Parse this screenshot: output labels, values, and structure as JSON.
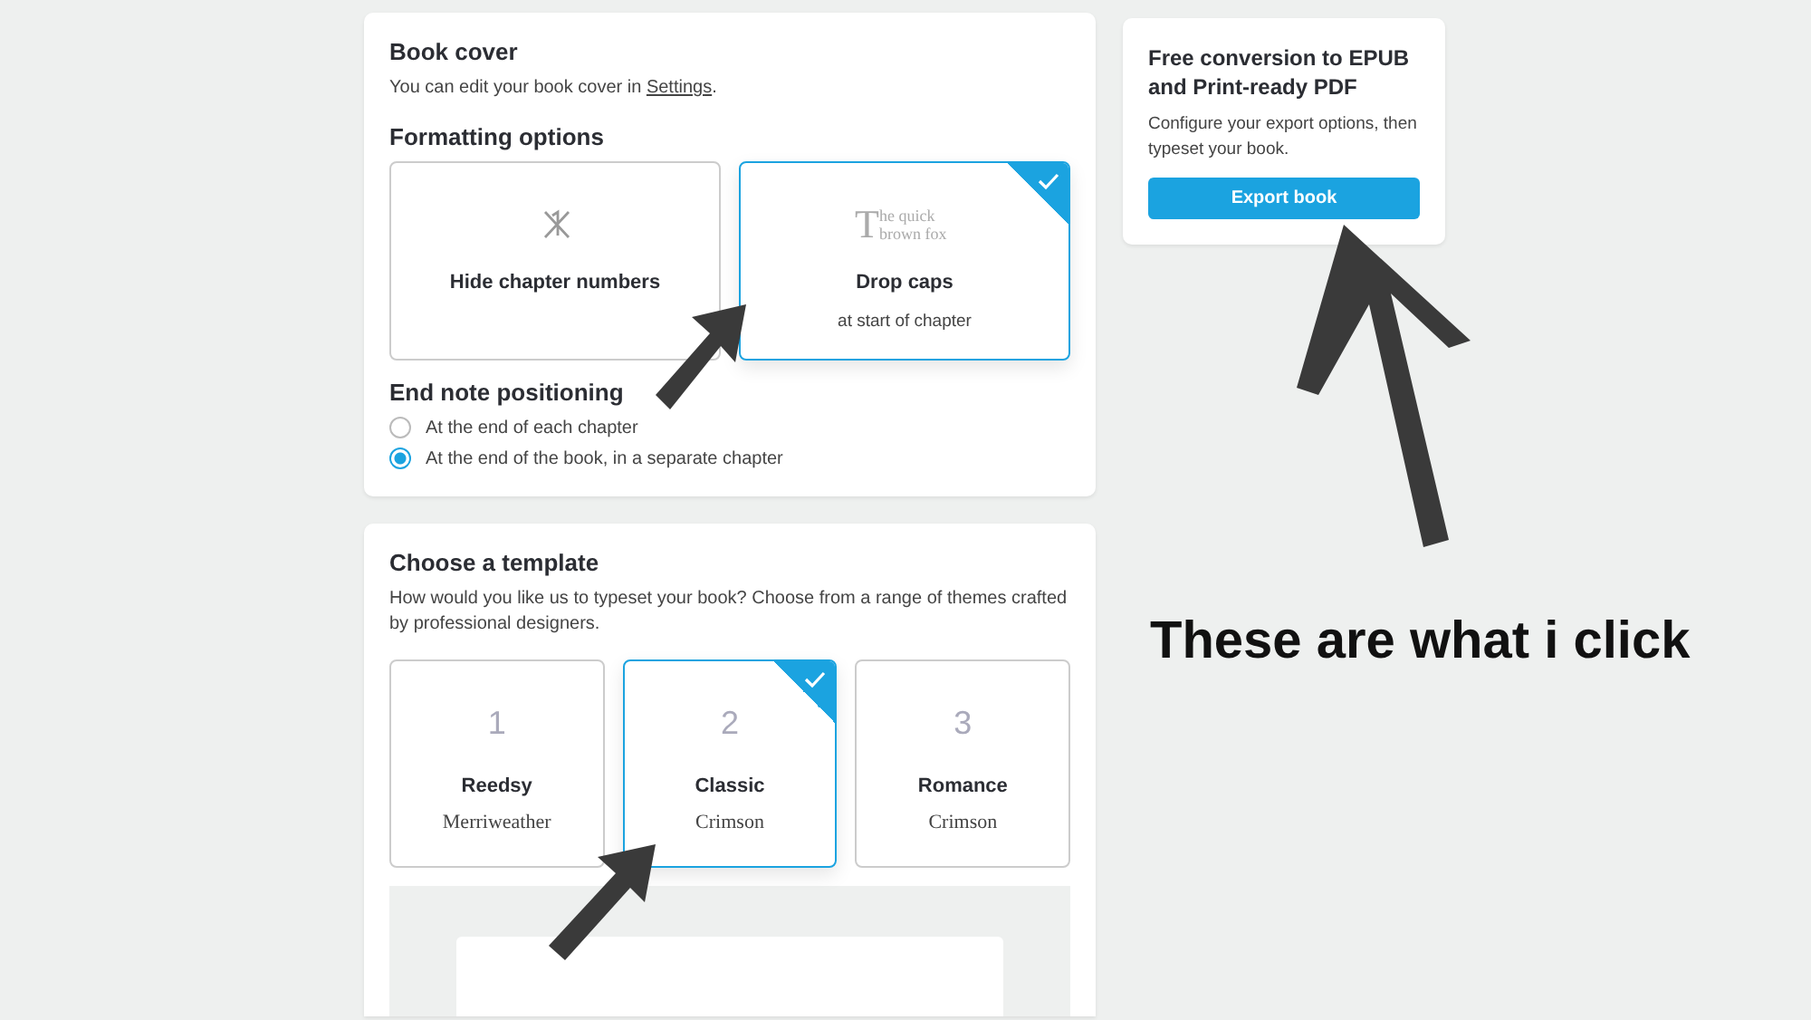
{
  "book_cover": {
    "title": "Book cover",
    "text_before": "You can edit your book cover in ",
    "link": "Settings",
    "text_after": "."
  },
  "formatting": {
    "title": "Formatting options",
    "options": [
      {
        "kind": "icon",
        "label": "Hide chapter numbers",
        "selected": false
      },
      {
        "kind": "sample",
        "sample_cap": "T",
        "sample_text": "he quick brown fox",
        "label": "Drop caps",
        "sublabel": "at start of chapter",
        "selected": true
      }
    ]
  },
  "end_notes": {
    "title": "End note positioning",
    "options": [
      {
        "label": "At the end of each chapter",
        "selected": false
      },
      {
        "label": "At the end of the book, in a separate chapter",
        "selected": true
      }
    ]
  },
  "templates": {
    "title": "Choose a template",
    "text": "How would you like us to typeset your book? Choose from a range of themes crafted by professional designers.",
    "items": [
      {
        "number": "1",
        "name": "Reedsy",
        "font": "Merriweather",
        "selected": false
      },
      {
        "number": "2",
        "name": "Classic",
        "font": "Crimson",
        "selected": true
      },
      {
        "number": "3",
        "name": "Romance",
        "font": "Crimson",
        "selected": false
      }
    ]
  },
  "export": {
    "title": "Free conversion to EPUB and Print-ready PDF",
    "text": "Configure your export options, then typeset your book.",
    "button": "Export book"
  },
  "annotation": {
    "text": "These are what i click"
  }
}
